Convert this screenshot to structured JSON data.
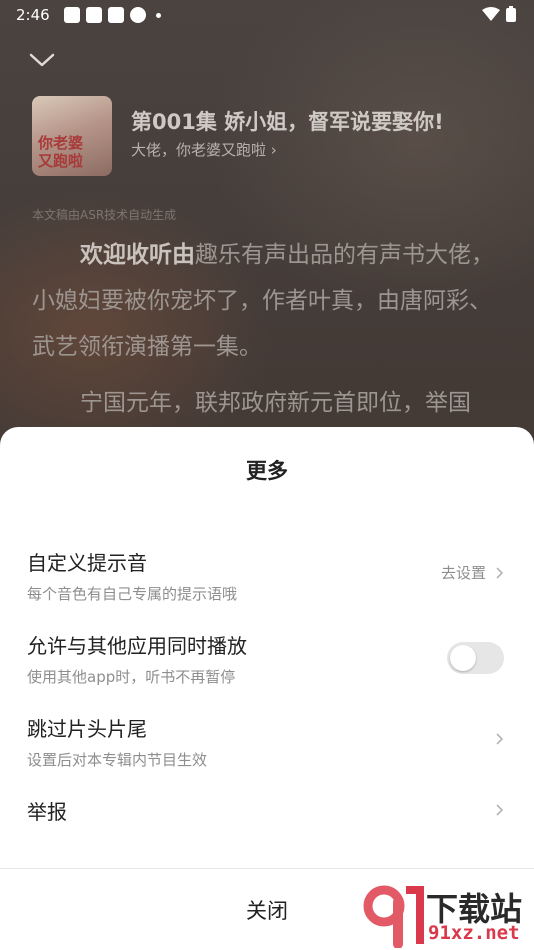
{
  "status_bar": {
    "time": "2:46"
  },
  "player": {
    "episode_title": "第001集 娇小姐，督军说要娶你!",
    "album_link": "大佬，你老婆又跑啦",
    "cover_text_line1": "你老婆",
    "cover_text_line2": "又跑啦",
    "asr_note": "本文稿由ASR技术自动生成",
    "transcript": {
      "lead": "欢迎收听由",
      "para1_rest": "趣乐有声出品的有声书大佬，小媳妇要被你宠坏了，作者叶真，由唐阿彩、武艺领衔演播第一集。",
      "para2": "宁国元年，联邦政府新元首即位，举国"
    }
  },
  "sheet": {
    "title": "更多",
    "items": [
      {
        "label": "自定义提示音",
        "desc": "每个音色有自己专属的提示语哦",
        "action_label": "去设置"
      },
      {
        "label": "允许与其他应用同时播放",
        "desc": "使用其他app时，听书不再暂停",
        "toggle_on": false
      },
      {
        "label": "跳过片头片尾",
        "desc": "设置后对本专辑内节目生效"
      },
      {
        "label": "举报"
      }
    ],
    "close_label": "关闭"
  },
  "watermark": {
    "top": "下载站",
    "bottom": "91xz.net"
  },
  "colors": {
    "sheet_bg": "#ffffff",
    "toggle_off": "#e6e6e6",
    "watermark_red": "#d9394a"
  }
}
